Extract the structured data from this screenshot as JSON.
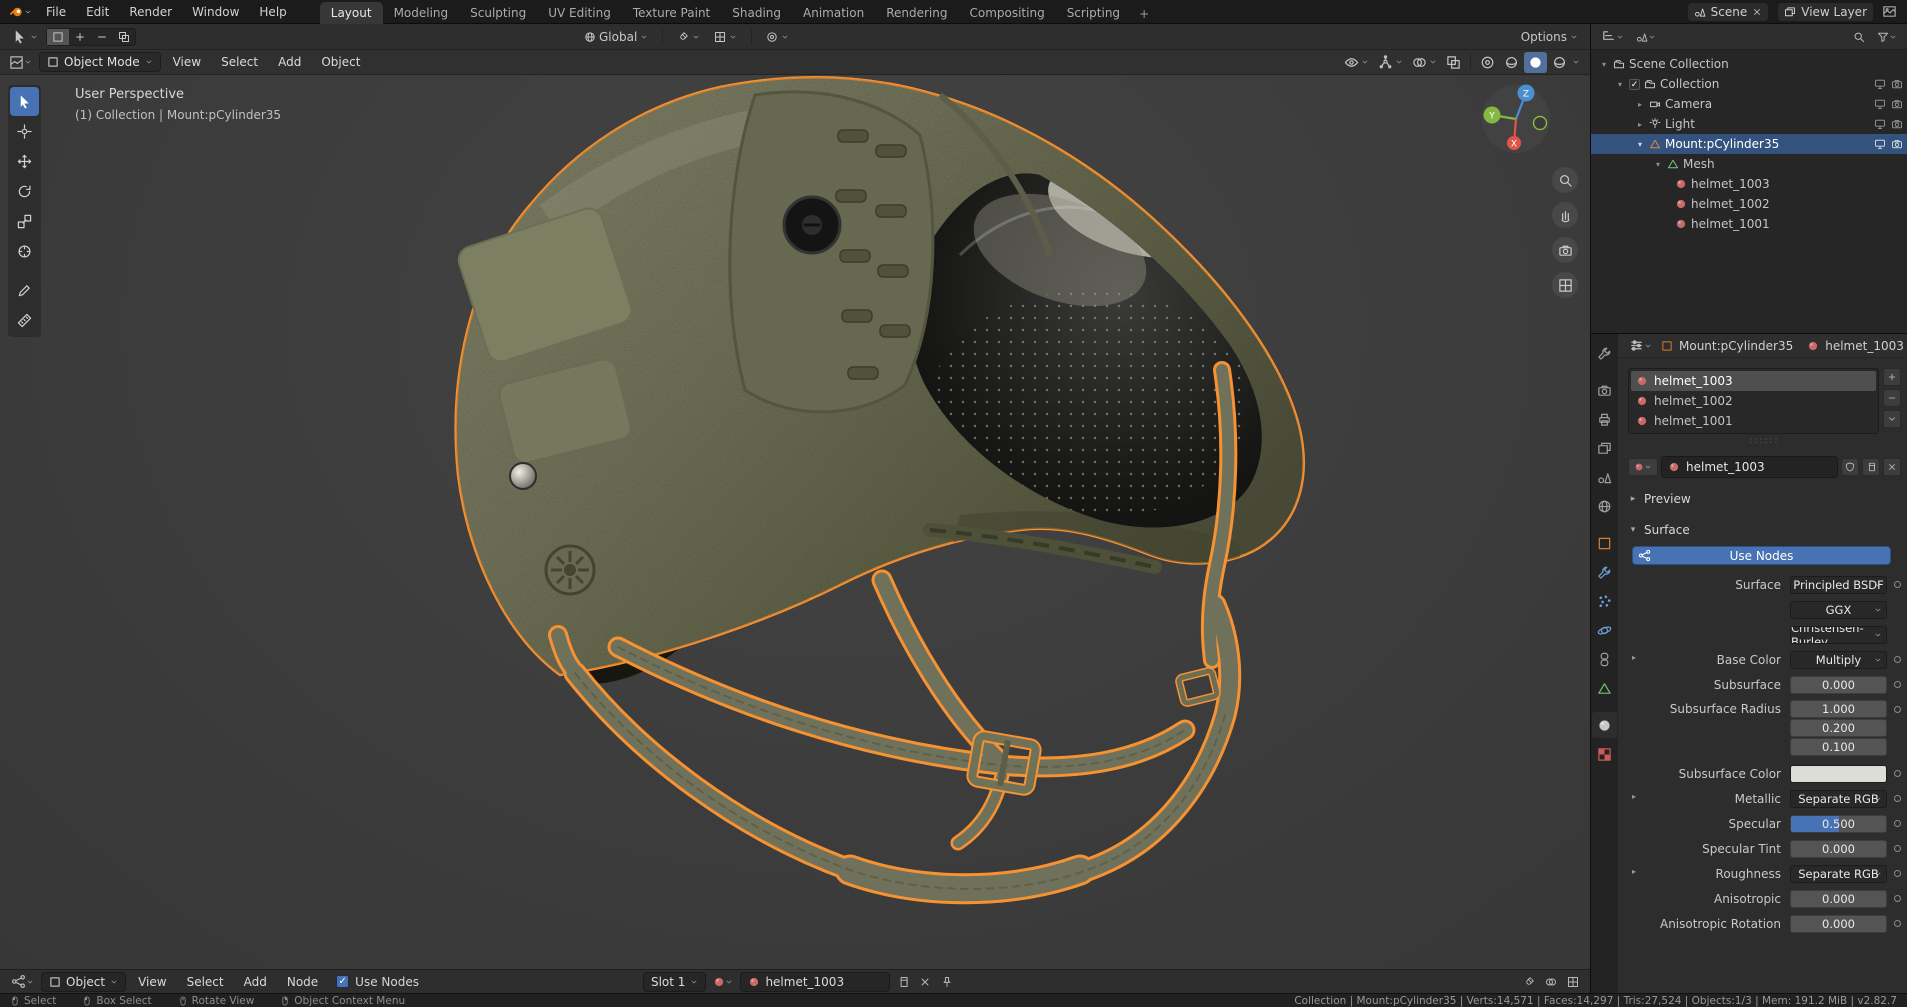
{
  "topbar": {
    "menus": [
      "File",
      "Edit",
      "Render",
      "Window",
      "Help"
    ],
    "workspaces": [
      "Layout",
      "Modeling",
      "Sculpting",
      "UV Editing",
      "Texture Paint",
      "Shading",
      "Animation",
      "Rendering",
      "Compositing",
      "Scripting"
    ],
    "add_workspace": "+",
    "scene_name": "Scene",
    "view_layer_name": "View Layer"
  },
  "tool_settings": {
    "orientation": "Global",
    "options_label": "Options"
  },
  "viewport": {
    "mode": "Object Mode",
    "menus": [
      "View",
      "Select",
      "Add",
      "Object"
    ],
    "overlay_line1": "User Perspective",
    "overlay_line2": "(1) Collection | Mount:pCylinder35",
    "axis_labels": {
      "x": "X",
      "y": "Y",
      "z": "Z"
    }
  },
  "outliner": {
    "rows": {
      "scene_collection": "Scene Collection",
      "collection": "Collection",
      "camera": "Camera",
      "light": "Light",
      "mount": "Mount:pCylinder35",
      "mesh": "Mesh",
      "helmet_1003": "helmet_1003",
      "helmet_1002": "helmet_1002",
      "helmet_1001": "helmet_1001"
    }
  },
  "properties": {
    "breadcrumb": {
      "object": "Mount:pCylinder35",
      "material": "helmet_1003"
    },
    "slots": [
      "helmet_1003",
      "helmet_1002",
      "helmet_1001"
    ],
    "material_name": "helmet_1003",
    "preview_label": "Preview",
    "surface_label": "Surface",
    "use_nodes_label": "Use Nodes",
    "surface_rows": {
      "surface": {
        "label": "Surface",
        "value": "Principled BSDF"
      },
      "distribution": {
        "value": "GGX"
      },
      "subsurface_method": {
        "value": "Christensen-Burley"
      },
      "base_color": {
        "label": "Base Color",
        "value": "Multiply"
      },
      "subsurface": {
        "label": "Subsurface",
        "value": "0.000"
      },
      "subsurface_radius": {
        "label": "Subsurface Radius",
        "values": [
          "1.000",
          "0.200",
          "0.100"
        ]
      },
      "subsurface_color": {
        "label": "Subsurface Color",
        "swatch": "#dcded6"
      },
      "metallic": {
        "label": "Metallic",
        "value": "Separate RGB"
      },
      "specular": {
        "label": "Specular",
        "value": "0.500",
        "fill_ratio": 0.5
      },
      "specular_tint": {
        "label": "Specular Tint",
        "value": "0.000"
      },
      "roughness": {
        "label": "Roughness",
        "value": "Separate RGB"
      },
      "anisotropic": {
        "label": "Anisotropic",
        "value": "0.000"
      },
      "anisotropic_rotation": {
        "label": "Anisotropic Rotation",
        "value": "0.000"
      }
    }
  },
  "shader_editor": {
    "type": "Object",
    "menus": [
      "View",
      "Select",
      "Add",
      "Node"
    ],
    "use_nodes_label": "Use Nodes",
    "slot": "Slot 1",
    "material": "helmet_1003"
  },
  "status_bar": {
    "hint_select": "Select",
    "hint_box_select": "Box Select",
    "hint_rotate": "Rotate View",
    "hint_context": "Object Context Menu",
    "stats": "Collection | Mount:pCylinder35 | Verts:14,571 | Faces:14,297 | Tris:27,524 | Objects:1/3 | Mem: 191.2 MiB | v2.82.7"
  }
}
